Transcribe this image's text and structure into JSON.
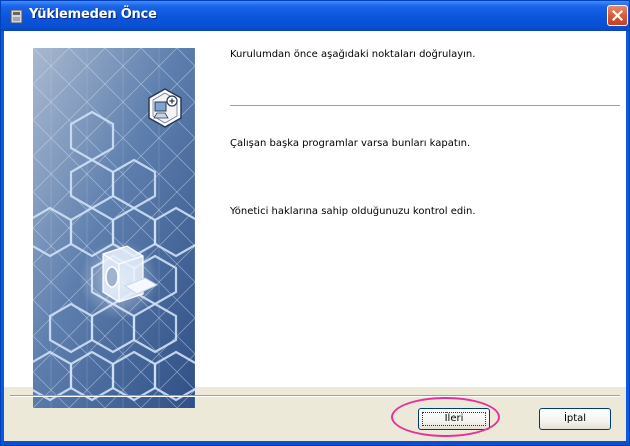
{
  "window": {
    "title": "Yüklemeden Önce",
    "icons": {
      "title": "installer-app-icon",
      "close": "close-x-icon"
    }
  },
  "content": {
    "intro": "Kurulumdan önce aşağıdaki noktaları doğrulayın.",
    "item1": "Çalışan başka programlar varsa bunları kapatın.",
    "item2": "Yönetici haklarına sahip olduğunuzu kontrol edin."
  },
  "buttons": {
    "next_label": "İleri",
    "cancel_label": "İptal"
  },
  "colors": {
    "title_bar": "#0a55dc",
    "highlight": "#e4329a",
    "art_background": "#4d6fa0"
  }
}
